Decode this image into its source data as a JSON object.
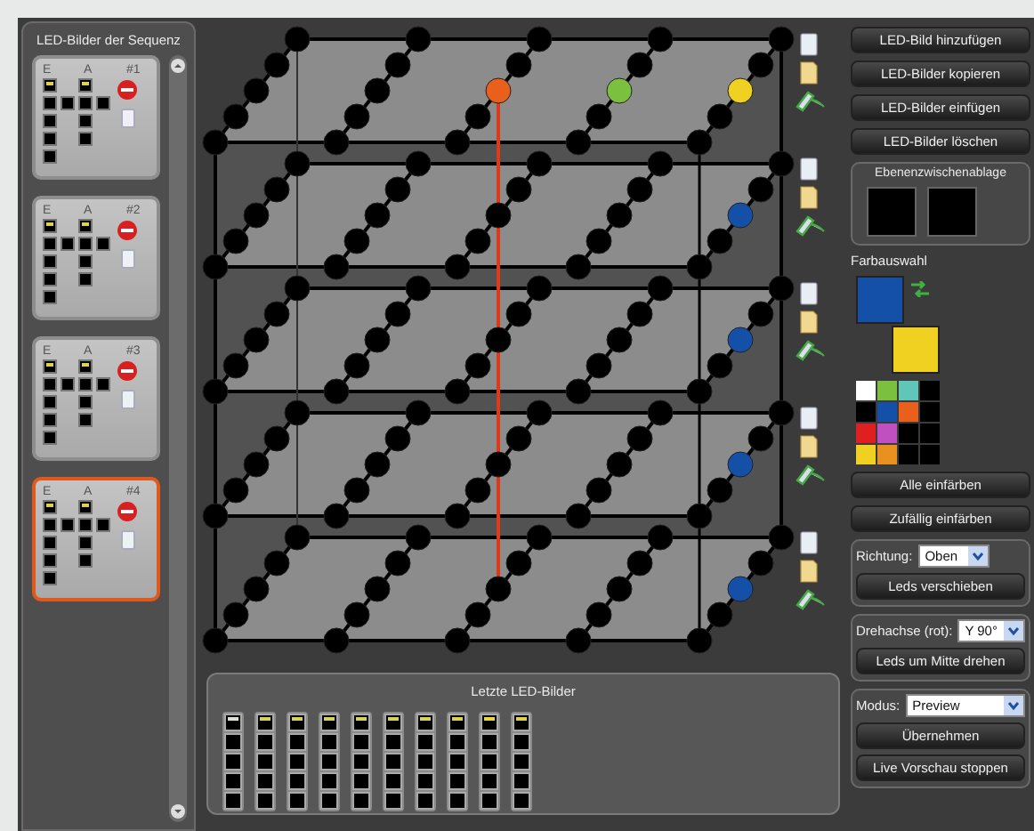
{
  "sequence_panel": {
    "title": "LED-Bilder der Sequenz",
    "cards": [
      {
        "e_label": "E",
        "a_label": "A",
        "number": "#1",
        "selected": false
      },
      {
        "e_label": "E",
        "a_label": "A",
        "number": "#2",
        "selected": false
      },
      {
        "e_label": "E",
        "a_label": "A",
        "number": "#3",
        "selected": false
      },
      {
        "e_label": "E",
        "a_label": "A",
        "number": "#4",
        "selected": true
      }
    ]
  },
  "cube": {
    "layers": [
      {
        "leds": [
          {
            "color": "#000000"
          },
          {
            "color": "#000000"
          },
          {
            "color": "#000000"
          },
          {
            "color": "#000000"
          },
          {
            "color": "#000000"
          },
          {
            "color": "#000000"
          },
          {
            "color": "#000000"
          },
          {
            "color": "#000000"
          },
          {
            "color": "#000000"
          },
          {
            "color": "#000000"
          },
          {
            "color": "#000000"
          },
          {
            "color": "#000000"
          },
          {
            "color": "#e8601c"
          },
          {
            "color": "#7cc040"
          },
          {
            "color": "#f0d020"
          },
          {
            "color": "#000000"
          },
          {
            "color": "#000000"
          },
          {
            "color": "#000000"
          },
          {
            "color": "#000000"
          },
          {
            "color": "#000000"
          },
          {
            "color": "#000000"
          },
          {
            "color": "#000000"
          },
          {
            "color": "#000000"
          },
          {
            "color": "#000000"
          },
          {
            "color": "#000000"
          }
        ]
      },
      {
        "leds": [
          {
            "color": "#000000"
          },
          {
            "color": "#000000"
          },
          {
            "color": "#000000"
          },
          {
            "color": "#000000"
          },
          {
            "color": "#000000"
          },
          {
            "color": "#000000"
          },
          {
            "color": "#000000"
          },
          {
            "color": "#000000"
          },
          {
            "color": "#000000"
          },
          {
            "color": "#000000"
          },
          {
            "color": "#000000"
          },
          {
            "color": "#000000"
          },
          {
            "color": "#000000"
          },
          {
            "color": "#000000"
          },
          {
            "color": "#1450a8"
          },
          {
            "color": "#000000"
          },
          {
            "color": "#000000"
          },
          {
            "color": "#000000"
          },
          {
            "color": "#000000"
          },
          {
            "color": "#000000"
          },
          {
            "color": "#000000"
          },
          {
            "color": "#000000"
          },
          {
            "color": "#000000"
          },
          {
            "color": "#000000"
          },
          {
            "color": "#000000"
          }
        ]
      },
      {
        "leds": [
          {
            "color": "#000000"
          },
          {
            "color": "#000000"
          },
          {
            "color": "#000000"
          },
          {
            "color": "#000000"
          },
          {
            "color": "#000000"
          },
          {
            "color": "#000000"
          },
          {
            "color": "#000000"
          },
          {
            "color": "#000000"
          },
          {
            "color": "#000000"
          },
          {
            "color": "#000000"
          },
          {
            "color": "#000000"
          },
          {
            "color": "#000000"
          },
          {
            "color": "#000000"
          },
          {
            "color": "#000000"
          },
          {
            "color": "#1450a8"
          },
          {
            "color": "#000000"
          },
          {
            "color": "#000000"
          },
          {
            "color": "#000000"
          },
          {
            "color": "#000000"
          },
          {
            "color": "#000000"
          },
          {
            "color": "#000000"
          },
          {
            "color": "#000000"
          },
          {
            "color": "#000000"
          },
          {
            "color": "#000000"
          },
          {
            "color": "#000000"
          }
        ]
      },
      {
        "leds": [
          {
            "color": "#000000"
          },
          {
            "color": "#000000"
          },
          {
            "color": "#000000"
          },
          {
            "color": "#000000"
          },
          {
            "color": "#000000"
          },
          {
            "color": "#000000"
          },
          {
            "color": "#000000"
          },
          {
            "color": "#000000"
          },
          {
            "color": "#000000"
          },
          {
            "color": "#000000"
          },
          {
            "color": "#000000"
          },
          {
            "color": "#000000"
          },
          {
            "color": "#000000"
          },
          {
            "color": "#000000"
          },
          {
            "color": "#1450a8"
          },
          {
            "color": "#000000"
          },
          {
            "color": "#000000"
          },
          {
            "color": "#000000"
          },
          {
            "color": "#000000"
          },
          {
            "color": "#000000"
          },
          {
            "color": "#000000"
          },
          {
            "color": "#000000"
          },
          {
            "color": "#000000"
          },
          {
            "color": "#000000"
          },
          {
            "color": "#000000"
          }
        ]
      },
      {
        "leds": [
          {
            "color": "#000000"
          },
          {
            "color": "#000000"
          },
          {
            "color": "#000000"
          },
          {
            "color": "#000000"
          },
          {
            "color": "#000000"
          },
          {
            "color": "#000000"
          },
          {
            "color": "#000000"
          },
          {
            "color": "#000000"
          },
          {
            "color": "#000000"
          },
          {
            "color": "#000000"
          },
          {
            "color": "#000000"
          },
          {
            "color": "#000000"
          },
          {
            "color": "#000000"
          },
          {
            "color": "#000000"
          },
          {
            "color": "#1450a8"
          },
          {
            "color": "#000000"
          },
          {
            "color": "#000000"
          },
          {
            "color": "#000000"
          },
          {
            "color": "#000000"
          },
          {
            "color": "#000000"
          },
          {
            "color": "#000000"
          },
          {
            "color": "#000000"
          },
          {
            "color": "#000000"
          },
          {
            "color": "#000000"
          },
          {
            "color": "#000000"
          }
        ]
      }
    ]
  },
  "recent_panel": {
    "title": "Letzte LED-Bilder",
    "thumbnails": [
      {
        "color": "#e0e0d0"
      },
      {
        "color": "#d8d060"
      },
      {
        "color": "#d8d060"
      },
      {
        "color": "#d8d060"
      },
      {
        "color": "#d8d060"
      },
      {
        "color": "#d8d060"
      },
      {
        "color": "#d8d060"
      },
      {
        "color": "#e0d050"
      },
      {
        "color": "#e8d840"
      },
      {
        "color": "#e0d050"
      }
    ]
  },
  "actions": [
    "LED-Bild hinzufügen",
    "LED-Bilder kopieren",
    "LED-Bilder einfügen",
    "LED-Bilder löschen"
  ],
  "layer_clipboard": {
    "title": "Ebenenzwischenablage"
  },
  "color_selection": {
    "title": "Farbauswahl",
    "primary": {
      "color": "#1450a8"
    },
    "secondary": {
      "color": "#f0d020"
    },
    "palette": [
      {
        "color": "#ffffff"
      },
      {
        "color": "#7cc040"
      },
      {
        "color": "#5fc6b8"
      },
      {
        "color": "#000000"
      },
      {
        "color": "#000000"
      },
      {
        "color": "#1450a8"
      },
      {
        "color": "#e8601c"
      },
      {
        "color": "#000000"
      },
      {
        "color": "#e02020"
      },
      {
        "color": "#c050c0"
      },
      {
        "color": "#000000"
      },
      {
        "color": "#000000"
      },
      {
        "color": "#f0d020"
      },
      {
        "color": "#e89020"
      },
      {
        "color": "#000000"
      },
      {
        "color": "#000000"
      }
    ]
  },
  "color_buttons": [
    "Alle einfärben",
    "Zufällig einfärben"
  ],
  "shift": {
    "label": "Richtung:",
    "value": "Oben",
    "button": "Leds verschieben"
  },
  "rotate": {
    "label": "Drehachse (rot):",
    "value": "Y 90°",
    "button": "Leds um Mitte drehen"
  },
  "mode": {
    "label": "Modus:",
    "value": "Preview",
    "buttons": [
      "Übernehmen",
      "Live Vorschau stoppen"
    ]
  }
}
